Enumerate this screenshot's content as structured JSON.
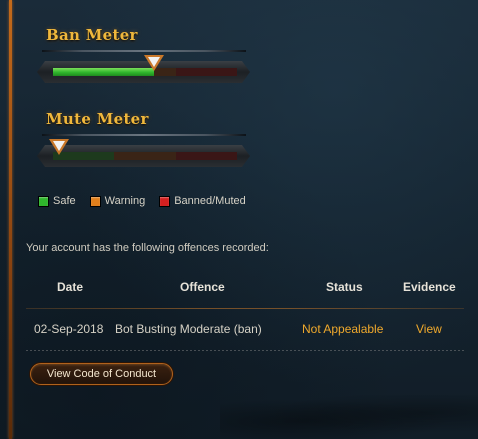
{
  "ban_meter": {
    "title": "Ban Meter",
    "level": 0.55
  },
  "mute_meter": {
    "title": "Mute Meter",
    "level": 0.0
  },
  "legend": [
    {
      "label": "Safe",
      "color": "#2fb52c"
    },
    {
      "label": "Warning",
      "color": "#e07f1c"
    },
    {
      "label": "Banned/Muted",
      "color": "#d42020"
    }
  ],
  "notice": "Your account has the following offences recorded:",
  "table": {
    "headers": [
      "Date",
      "Offence",
      "Status",
      "Evidence"
    ],
    "rows": [
      {
        "date": "02-Sep-2018",
        "offence": "Bot Busting Moderate (ban)",
        "status": "Not Appealable",
        "evidence": "View"
      }
    ]
  },
  "button": {
    "label": "View Code of Conduct"
  },
  "colors": {
    "accent": "#f0a92c",
    "title": "#f0b83c",
    "rail": "#c46a1a"
  }
}
